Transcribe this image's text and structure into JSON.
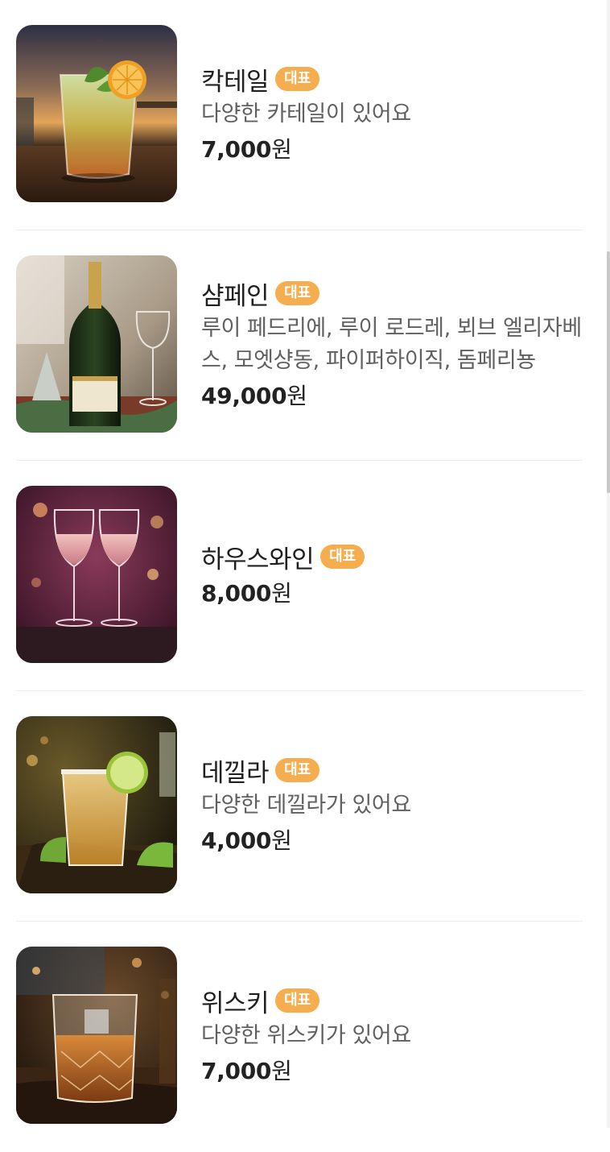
{
  "theme": {
    "badge_color": "#f4ad4f",
    "name_color": "#1f1f1f",
    "desc_color": "#606060",
    "price_color": "#222222",
    "divider_color": "#ececec"
  },
  "menu": {
    "items": [
      {
        "name": "칵테일",
        "badge": "대표",
        "description": "다양한 카테일이 있어요",
        "price": "7,000",
        "currency": "원",
        "image": "cocktail-photo"
      },
      {
        "name": "샴페인",
        "badge": "대표",
        "description": "루이 페드리에, 루이 로드레, 뵈브 엘리자베스, 모엣샹동, 파이퍼하이직, 돔페리뇽",
        "price": "49,000",
        "currency": "원",
        "image": "champagne-photo"
      },
      {
        "name": "하우스와인",
        "badge": "대표",
        "description": "",
        "price": "8,000",
        "currency": "원",
        "image": "house-wine-photo"
      },
      {
        "name": "데낄라",
        "badge": "대표",
        "description": "다양한 데낄라가 있어요",
        "price": "4,000",
        "currency": "원",
        "image": "tequila-photo"
      },
      {
        "name": "위스키",
        "badge": "대표",
        "description": "다양한 위스키가 있어요",
        "price": "7,000",
        "currency": "원",
        "image": "whiskey-photo"
      }
    ]
  }
}
